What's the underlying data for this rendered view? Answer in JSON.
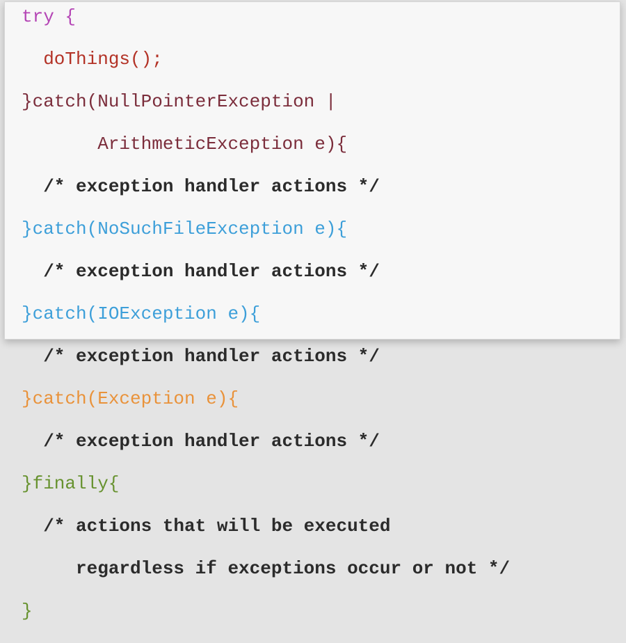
{
  "colors": {
    "try": "#b445b5",
    "doThings": "#b33226",
    "null_catch": "#7b2d3b",
    "arith": "#7b2d3b",
    "nosuchfile": "#3d9fd9",
    "ioexception": "#3d9fd9",
    "exception": "#e9923a",
    "finally": "#67922f",
    "comment": "#2b2b2b"
  },
  "lines": [
    {
      "text": "try {",
      "role": "keyword",
      "color_key": "try"
    },
    {
      "text": "  doThings();",
      "role": "code",
      "color_key": "doThings"
    },
    {
      "text": "}catch(NullPointerException |",
      "role": "code",
      "color_key": "null_catch"
    },
    {
      "text": "       ArithmeticException e){",
      "role": "code",
      "color_key": "arith"
    },
    {
      "text": "  /* exception handler actions */",
      "role": "comment",
      "color_key": "comment"
    },
    {
      "text": "}catch(NoSuchFileException e){",
      "role": "code",
      "color_key": "nosuchfile"
    },
    {
      "text": "  /* exception handler actions */",
      "role": "comment",
      "color_key": "comment"
    },
    {
      "text": "}catch(IOException e){",
      "role": "code",
      "color_key": "ioexception"
    },
    {
      "text": "  /* exception handler actions */",
      "role": "comment",
      "color_key": "comment"
    },
    {
      "text": "}catch(Exception e){",
      "role": "code",
      "color_key": "exception"
    },
    {
      "text": "  /* exception handler actions */",
      "role": "comment",
      "color_key": "comment"
    },
    {
      "text": "}finally{",
      "role": "code",
      "color_key": "finally"
    },
    {
      "text": "  /* actions that will be executed",
      "role": "comment",
      "color_key": "comment"
    },
    {
      "text": "     regardless if exceptions occur or not */",
      "role": "comment",
      "color_key": "comment"
    },
    {
      "text": "}",
      "role": "code",
      "color_key": "finally"
    }
  ]
}
